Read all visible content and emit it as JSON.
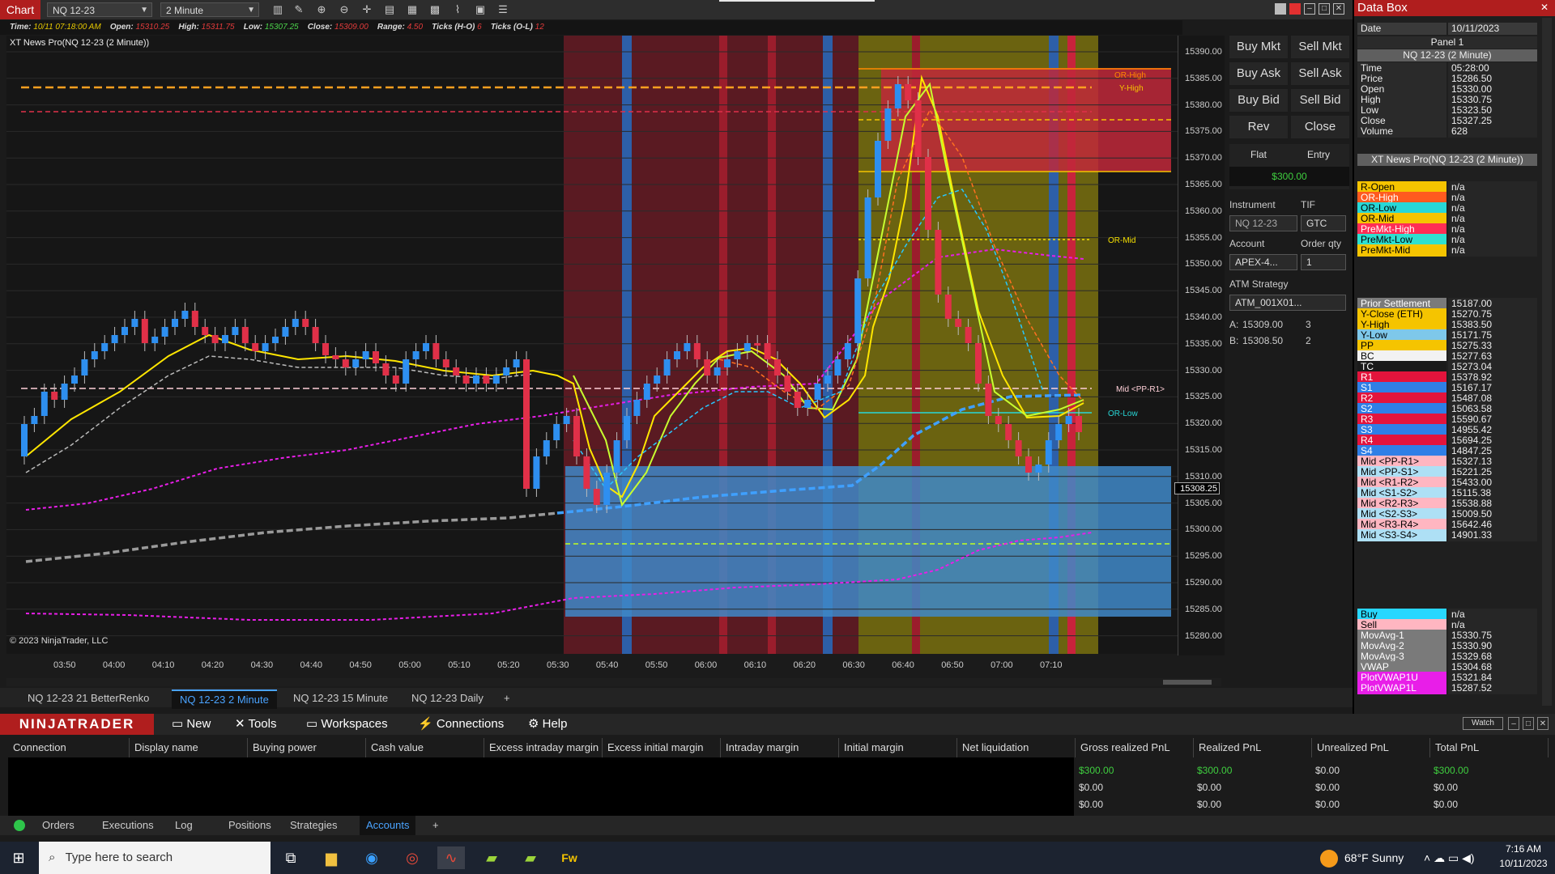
{
  "window": {
    "chart_label": "Chart",
    "instrument": "NQ 12-23",
    "interval": "2 Minute"
  },
  "info": {
    "time_label": "Time:",
    "time": "10/11 07:18:00 AM",
    "open_label": "Open:",
    "open": "15310.25",
    "high_label": "High:",
    "high": "15311.75",
    "low_label": "Low:",
    "low": "15307.25",
    "close_label": "Close:",
    "close": "15309.00",
    "range_label": "Range:",
    "range": "4.50",
    "ticks_ho_label": "Ticks (H-O)",
    "ticks_ho": "6",
    "ticks_ol_label": "Ticks (O-L)",
    "ticks_ol": "12"
  },
  "indicator_title": "XT News Pro(NQ 12-23 (2 Minute))",
  "copyright": "© 2023 NinjaTrader, LLC",
  "price_axis": [
    "15390.00",
    "15385.00",
    "15380.00",
    "15375.00",
    "15370.00",
    "15365.00",
    "15360.00",
    "15355.00",
    "15350.00",
    "15345.00",
    "15340.00",
    "15335.00",
    "15330.00",
    "15325.00",
    "15320.00",
    "15315.00",
    "15310.00",
    "15305.00",
    "15300.00",
    "15295.00",
    "15290.00",
    "15285.00",
    "15280.00"
  ],
  "current_price": "15308.25",
  "time_axis": [
    "03:50",
    "04:00",
    "04:10",
    "04:20",
    "04:30",
    "04:40",
    "04:50",
    "05:00",
    "05:10",
    "05:20",
    "05:30",
    "05:40",
    "05:50",
    "06:00",
    "06:10",
    "06:20",
    "06:30",
    "06:40",
    "06:50",
    "07:00",
    "07:10"
  ],
  "chart_labels": {
    "or_high": "OR-High",
    "y_high": "Y-High",
    "or_mid": "OR-Mid",
    "mid_pp_r1": "Mid <PP-R1>",
    "or_low": "OR-Low"
  },
  "chart_tabs": [
    "NQ 12-23 21 BetterRenko",
    "NQ 12-23 2 Minute",
    "NQ 12-23 15 Minute",
    "NQ 12-23 Daily"
  ],
  "add_tab": "+",
  "trader": {
    "buy_mkt": "Buy Mkt",
    "sell_mkt": "Sell Mkt",
    "buy_ask": "Buy Ask",
    "sell_ask": "Sell Ask",
    "buy_bid": "Buy Bid",
    "sell_bid": "Sell Bid",
    "rev": "Rev",
    "close": "Close",
    "flat": "Flat",
    "entry": "Entry",
    "pnl": "$300.00",
    "instrument_label": "Instrument",
    "tif_label": "TIF",
    "instrument_value": "NQ 12-23",
    "tif_value": "GTC",
    "account_label": "Account",
    "qty_label": "Order qty",
    "account_value": "APEX-4...",
    "qty_value": "1",
    "atm_label": "ATM Strategy",
    "atm_value": "ATM_001X01...",
    "ask_label": "A:",
    "ask_price": "15309.00",
    "ask_size": "3",
    "bid_label": "B:",
    "bid_price": "15308.50",
    "bid_size": "2"
  },
  "databox": {
    "title": "Data Box",
    "date_label": "Date",
    "date_value": "10/11/2023",
    "panel": "Panel 1",
    "series": "NQ 12-23 (2 Minute)",
    "ohlc": [
      {
        "k": "Time",
        "v": "05:28:00"
      },
      {
        "k": "Price",
        "v": "15286.50"
      },
      {
        "k": "Open",
        "v": "15330.00"
      },
      {
        "k": "High",
        "v": "15330.75"
      },
      {
        "k": "Low",
        "v": "15323.50"
      },
      {
        "k": "Close",
        "v": "15327.25"
      },
      {
        "k": "Volume",
        "v": "628"
      }
    ],
    "indicator": "XT News Pro(NQ 12-23 (2 Minute))",
    "group1": [
      {
        "k": "R-Open",
        "v": "n/a",
        "c": "#f5c400",
        "t": "#000"
      },
      {
        "k": "OR-High",
        "v": "n/a",
        "c": "#ff5a1f",
        "t": "#fff"
      },
      {
        "k": "OR-Low",
        "v": "n/a",
        "c": "#28d7d7",
        "t": "#000"
      },
      {
        "k": "OR-Mid",
        "v": "n/a",
        "c": "#f5c400",
        "t": "#000"
      },
      {
        "k": "PreMkt-High",
        "v": "n/a",
        "c": "#ff2d55",
        "t": "#fff"
      },
      {
        "k": "PreMkt-Low",
        "v": "n/a",
        "c": "#2ee0d0",
        "t": "#000"
      },
      {
        "k": "PreMkt-Mid",
        "v": "n/a",
        "c": "#f5c400",
        "t": "#000"
      }
    ],
    "group2": [
      {
        "k": "Prior Settlement",
        "v": "15187.00",
        "c": "#7a7a7a",
        "t": "#fff"
      },
      {
        "k": "Y-Close (ETH)",
        "v": "15270.75",
        "c": "#f5c400",
        "t": "#000"
      },
      {
        "k": "Y-High",
        "v": "15383.50",
        "c": "#f5c400",
        "t": "#000"
      },
      {
        "k": "Y-Low",
        "v": "15171.75",
        "c": "#7ec8ea",
        "t": "#000"
      },
      {
        "k": "PP",
        "v": "15275.33",
        "c": "#f5c400",
        "t": "#000"
      },
      {
        "k": "BC",
        "v": "15277.63",
        "c": "#f2f2f2",
        "t": "#000"
      },
      {
        "k": "TC",
        "v": "15273.04",
        "c": "#1a1a1a",
        "t": "#fff"
      },
      {
        "k": "R1",
        "v": "15378.92",
        "c": "#e3143c",
        "t": "#fff"
      },
      {
        "k": "S1",
        "v": "15167.17",
        "c": "#2f7fe6",
        "t": "#fff"
      },
      {
        "k": "R2",
        "v": "15487.08",
        "c": "#e3143c",
        "t": "#fff"
      },
      {
        "k": "S2",
        "v": "15063.58",
        "c": "#2f7fe6",
        "t": "#fff"
      },
      {
        "k": "R3",
        "v": "15590.67",
        "c": "#e3143c",
        "t": "#fff"
      },
      {
        "k": "S3",
        "v": "14955.42",
        "c": "#2f7fe6",
        "t": "#fff"
      },
      {
        "k": "R4",
        "v": "15694.25",
        "c": "#e3143c",
        "t": "#fff"
      },
      {
        "k": "S4",
        "v": "14847.25",
        "c": "#2f7fe6",
        "t": "#fff"
      },
      {
        "k": "Mid <PP-R1>",
        "v": "15327.13",
        "c": "#ffb6c1",
        "t": "#000"
      },
      {
        "k": "Mid <PP-S1>",
        "v": "15221.25",
        "c": "#aee0f5",
        "t": "#000"
      },
      {
        "k": "Mid <R1-R2>",
        "v": "15433.00",
        "c": "#ffb6c1",
        "t": "#000"
      },
      {
        "k": "Mid <S1-S2>",
        "v": "15115.38",
        "c": "#aee0f5",
        "t": "#000"
      },
      {
        "k": "Mid <R2-R3>",
        "v": "15538.88",
        "c": "#ffb6c1",
        "t": "#000"
      },
      {
        "k": "Mid <S2-S3>",
        "v": "15009.50",
        "c": "#aee0f5",
        "t": "#000"
      },
      {
        "k": "Mid <R3-R4>",
        "v": "15642.46",
        "c": "#ffb6c1",
        "t": "#000"
      },
      {
        "k": "Mid <S3-S4>",
        "v": "14901.33",
        "c": "#aee0f5",
        "t": "#000"
      }
    ],
    "group3": [
      {
        "k": "Buy",
        "v": "n/a",
        "c": "#28d7ff",
        "t": "#000"
      },
      {
        "k": "Sell",
        "v": "n/a",
        "c": "#ffb6c1",
        "t": "#000"
      },
      {
        "k": "MovAvg-1",
        "v": "15330.75",
        "c": "#7a7a7a",
        "t": "#fff"
      },
      {
        "k": "MovAvg-2",
        "v": "15330.90",
        "c": "#7a7a7a",
        "t": "#fff"
      },
      {
        "k": "MovAvg-3",
        "v": "15329.68",
        "c": "#7a7a7a",
        "t": "#fff"
      },
      {
        "k": "VWAP",
        "v": "15304.68",
        "c": "#7a7a7a",
        "t": "#fff"
      },
      {
        "k": "PlotVWAP1U",
        "v": "15321.84",
        "c": "#e81ee8",
        "t": "#fff"
      },
      {
        "k": "PlotVWAP1L",
        "v": "15287.52",
        "c": "#e81ee8",
        "t": "#fff"
      }
    ]
  },
  "cc": {
    "logo": "NINJATRADER",
    "menu": [
      "New",
      "Tools",
      "Workspaces",
      "Connections",
      "Help"
    ],
    "watch": "Watch",
    "columns": [
      "Connection",
      "Display name",
      "Buying power",
      "Cash value",
      "Excess intraday margin",
      "Excess initial margin",
      "Intraday margin",
      "Initial margin",
      "Net liquidation",
      "Gross realized PnL",
      "Realized PnL",
      "Unrealized PnL",
      "Total PnL"
    ],
    "rows": [
      {
        "gross": "$300.00",
        "realized": "$300.00",
        "unrealized": "$0.00",
        "total": "$300.00"
      },
      {
        "gross": "$0.00",
        "realized": "$0.00",
        "unrealized": "$0.00",
        "total": "$0.00"
      },
      {
        "gross": "$0.00",
        "realized": "$0.00",
        "unrealized": "$0.00",
        "total": "$0.00"
      }
    ],
    "tabs": [
      "Orders",
      "Executions",
      "Log",
      "Positions",
      "Strategies",
      "Accounts"
    ],
    "add_tab": "+"
  },
  "taskbar": {
    "search_placeholder": "Type here to search",
    "weather": "68°F  Sunny",
    "time": "7:16 AM",
    "date": "10/11/2023"
  },
  "chart_data": {
    "type": "candlestick",
    "y_range": [
      15278,
      15393
    ],
    "note_series": [
      "price bars",
      "moving averages",
      "VWAP",
      "VWAP bands"
    ]
  }
}
